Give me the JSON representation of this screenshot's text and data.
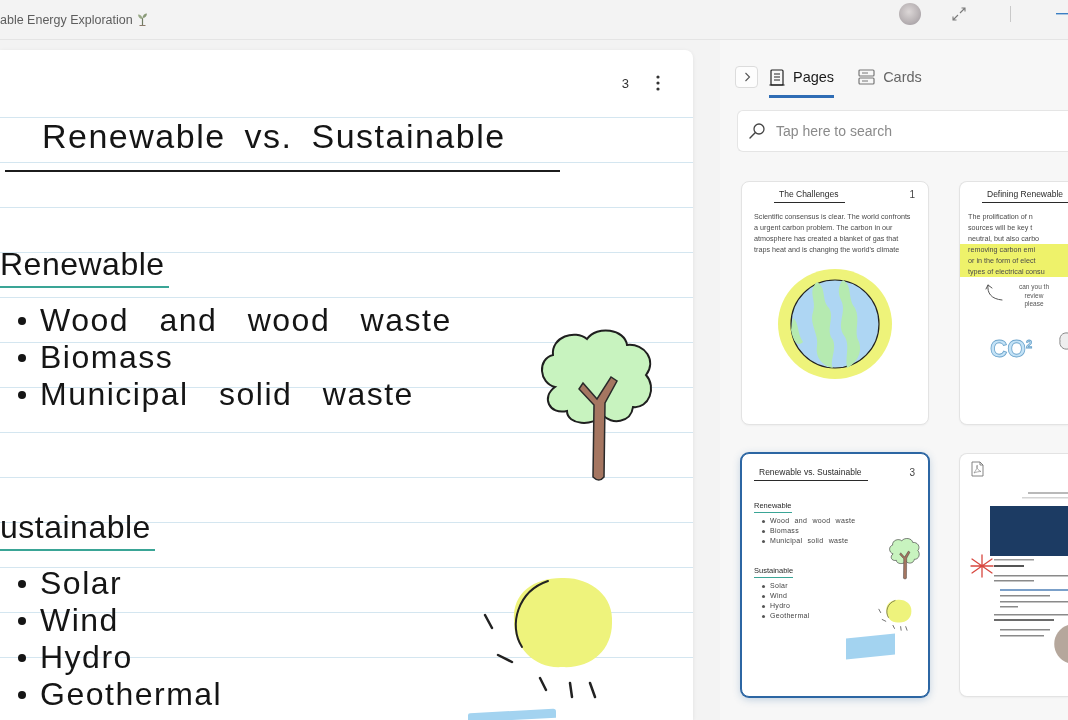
{
  "window": {
    "title": "able Energy Exploration"
  },
  "page": {
    "number": "3",
    "title": "Renewable vs. Sustainable",
    "sections": [
      {
        "heading": "Renewable",
        "items": [
          "Wood and wood waste",
          "Biomass",
          "Municipal solid waste"
        ]
      },
      {
        "heading": "ustainable",
        "items": [
          "Solar",
          "Wind",
          "Hydro",
          "Geothermal"
        ]
      }
    ]
  },
  "panel": {
    "tabs": [
      {
        "kind": "pages",
        "label": "Pages",
        "selected": true
      },
      {
        "kind": "cards",
        "label": "Cards",
        "selected": false
      }
    ],
    "search": {
      "placeholder": "Tap here to search"
    },
    "thumbnails": [
      {
        "kind": "paragraph",
        "title": "The Challenges",
        "number": "1",
        "selected": false,
        "text": "Scientific consensus is clear. The world confronts a urgent carbon problem. The carbon in our atmosphere has created a blanket of gas that traps heat and is changing the world's climate"
      },
      {
        "kind": "annotated",
        "title": "Defining Renewable",
        "selected": false,
        "lines": [
          {
            "text": "The prolification of n",
            "highlighted": false
          },
          {
            "text": "sources will be key t",
            "highlighted": false
          },
          {
            "text": "neutral, but also carbo",
            "highlighted": false
          },
          {
            "text": "removing carbon emi",
            "highlighted": true
          },
          {
            "text": "or in the form of elect",
            "highlighted": true
          },
          {
            "text": "types of electrical consu",
            "highlighted": true
          }
        ],
        "note": [
          "can you th",
          "review",
          "please"
        ],
        "sticker": "CO$^{2}$"
      },
      {
        "kind": "outline",
        "title": "Renewable vs. Sustainable",
        "number": "3",
        "selected": true,
        "sections": [
          {
            "heading": "Renewable",
            "items": [
              "Wood and wood waste",
              "Biomass",
              "Municipal solid waste"
            ]
          },
          {
            "heading": "Sustainable",
            "items": [
              "Solar",
              "Wind",
              "Hydro",
              "Geothermal"
            ]
          }
        ]
      },
      {
        "kind": "pdf",
        "selected": false
      }
    ]
  }
}
